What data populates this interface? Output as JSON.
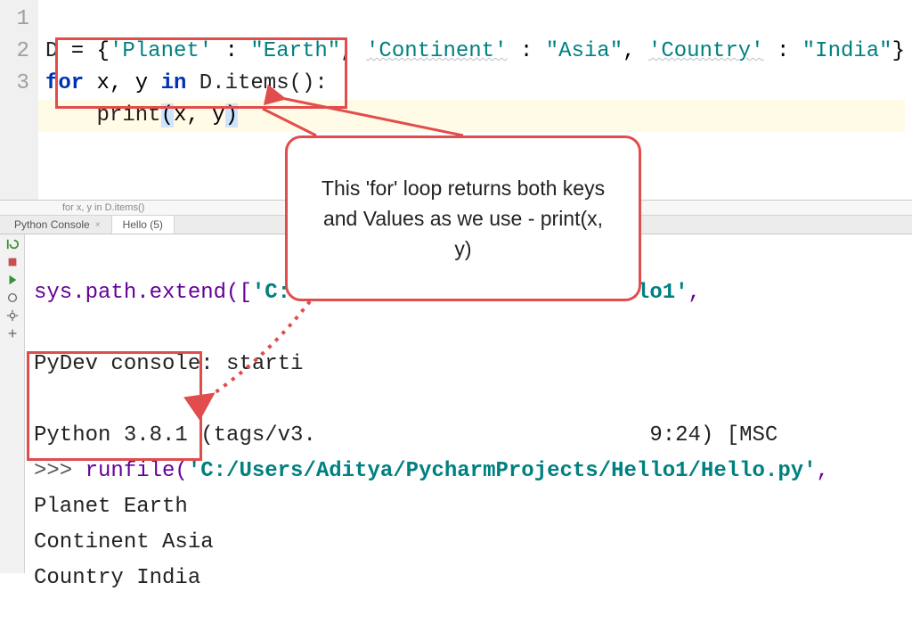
{
  "editor": {
    "gutter": [
      "1",
      "2",
      "3"
    ],
    "line1": {
      "var": "D",
      "eq": " = {",
      "k1": "'Planet'",
      "c1": " : ",
      "v1": "\"Earth\"",
      "s1": ", ",
      "k2": "'Continent'",
      "c2": " : ",
      "v2": "\"Asia\"",
      "s2": ", ",
      "k3": "'Country'",
      "c3": " : ",
      "v3": "\"India\"",
      "close": "}"
    },
    "line2": {
      "for": "for ",
      "vars": "x, y ",
      "in": "in ",
      "call": "D.items():"
    },
    "line3": {
      "indent": "    ",
      "print": "print",
      "open": "(",
      "args": "x, y",
      "close": ")"
    }
  },
  "breadcrumb": "for x, y in D.items()",
  "tabs": {
    "t1": "Python Console",
    "t2": "Hello (5)"
  },
  "console": {
    "l1a": "sys.path.extend([",
    "l1b": "'C:\\",
    "l1c": "\\\\Hello1'",
    "l1d": ",",
    "l2": "PyDev console: starti",
    "l3": "Python 3.8.1 (tags/v3.                          9:24) [MSC",
    "l4a": ">>> ",
    "l4b": "runfile(",
    "l4c": "'C:/Users/Aditya/PycharmProjects/Hello1/Hello.py'",
    "l4d": ",",
    "out1": "Planet Earth",
    "out2": "Continent Asia",
    "out3": "Country India"
  },
  "callout": {
    "text": "This 'for' loop returns both keys and Values as we use - print(x, y)"
  }
}
